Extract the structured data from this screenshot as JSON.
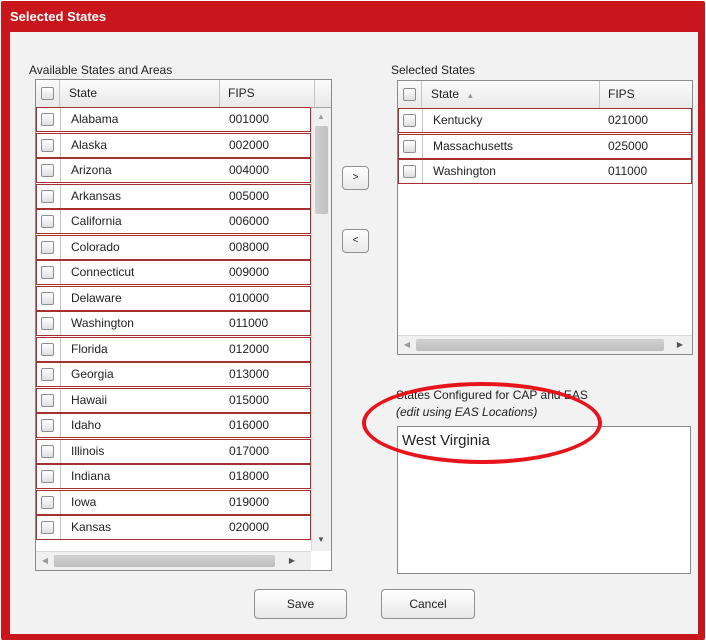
{
  "window": {
    "title": "Selected States"
  },
  "available": {
    "label": "Available States and Areas",
    "col_state": "State",
    "col_fips": "FIPS",
    "rows": [
      {
        "state": "Alabama",
        "fips": "001000"
      },
      {
        "state": "Alaska",
        "fips": "002000"
      },
      {
        "state": "Arizona",
        "fips": "004000"
      },
      {
        "state": "Arkansas",
        "fips": "005000"
      },
      {
        "state": "California",
        "fips": "006000"
      },
      {
        "state": "Colorado",
        "fips": "008000"
      },
      {
        "state": "Connecticut",
        "fips": "009000"
      },
      {
        "state": "Delaware",
        "fips": "010000"
      },
      {
        "state": "Washington",
        "fips": "011000"
      },
      {
        "state": "Florida",
        "fips": "012000"
      },
      {
        "state": "Georgia",
        "fips": "013000"
      },
      {
        "state": "Hawaii",
        "fips": "015000"
      },
      {
        "state": "Idaho",
        "fips": "016000"
      },
      {
        "state": "Illinois",
        "fips": "017000"
      },
      {
        "state": "Indiana",
        "fips": "018000"
      },
      {
        "state": "Iowa",
        "fips": "019000"
      },
      {
        "state": "Kansas",
        "fips": "020000"
      }
    ]
  },
  "selected": {
    "label": "Selected States",
    "col_state": "State",
    "col_fips": "FIPS",
    "sort_icon": "sort-ascending-icon",
    "rows": [
      {
        "state": "Kentucky",
        "fips": "021000"
      },
      {
        "state": "Massachusetts",
        "fips": "025000"
      },
      {
        "state": "Washington",
        "fips": "011000"
      }
    ]
  },
  "buttons": {
    "add": ">",
    "remove": "<",
    "save": "Save",
    "cancel": "Cancel"
  },
  "configured": {
    "label": "States Configured for CAP and EAS",
    "note": "(edit using EAS Locations)",
    "values": [
      "West Virginia"
    ]
  },
  "colors": {
    "frame": "#c9161d",
    "row_border": "#a53030",
    "highlight": "#e8141b"
  }
}
